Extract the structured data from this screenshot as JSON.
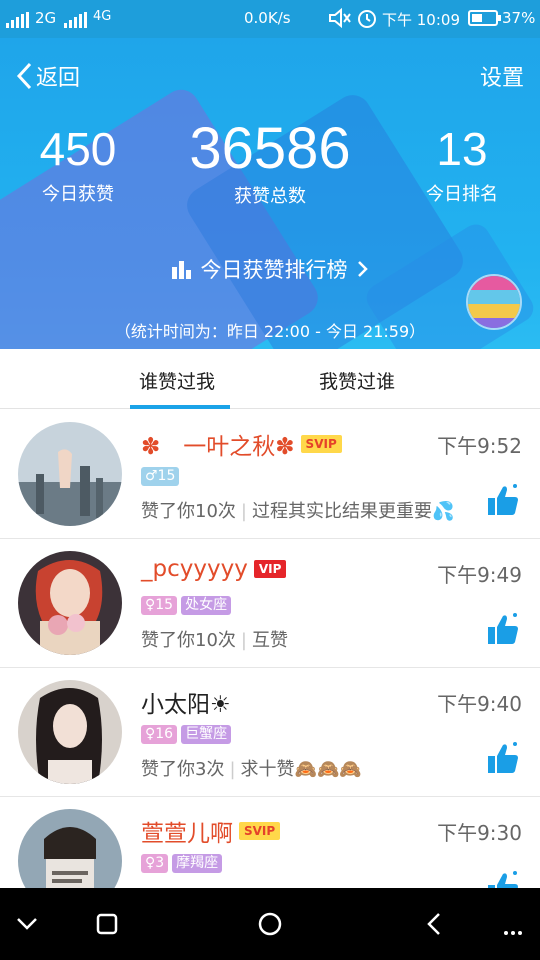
{
  "status": {
    "net1": "2G",
    "net2": "4G",
    "speed": "0.0K/s",
    "time": "下午 10:09",
    "battery": "37%"
  },
  "header": {
    "back_label": "返回",
    "settings_label": "设置",
    "stats": [
      {
        "value": "450",
        "label": "今日获赞"
      },
      {
        "value": "36586",
        "label": "获赞总数"
      },
      {
        "value": "13",
        "label": "今日排名"
      }
    ],
    "rank_link": "今日获赞排行榜",
    "period": "（统计时间为：昨日 22:00 - 今日 21:59）"
  },
  "tabs": [
    "谁赞过我",
    "我赞过谁"
  ],
  "items": [
    {
      "name": "✽　一叶之秋✽",
      "badge": "SVIP",
      "time": "下午9:52",
      "age_tag": "♂15",
      "star_tag": "",
      "likes": "赞了你10次",
      "note": "过程其实比结果更重要💦"
    },
    {
      "name": "_pcyyyyy",
      "badge": "VIP",
      "time": "下午9:49",
      "age_tag": "♀15",
      "star_tag": "处女座",
      "likes": "赞了你10次",
      "note": "互赞"
    },
    {
      "name": "小太阳☀",
      "badge": "",
      "time": "下午9:40",
      "age_tag": "♀16",
      "star_tag": "巨蟹座",
      "likes": "赞了你3次",
      "note": "求十赞🙈🙈🙈"
    },
    {
      "name": "萱萱儿啊",
      "badge": "SVIP",
      "time": "下午9:30",
      "age_tag": "♀3",
      "star_tag": "摩羯座",
      "likes": "",
      "note": ""
    }
  ],
  "colors": {
    "header_blue": "#1fa5ea",
    "accent_red": "#e24c2a",
    "tab_underline": "#1aa3e8",
    "thumb_blue": "#1a9ee6"
  }
}
